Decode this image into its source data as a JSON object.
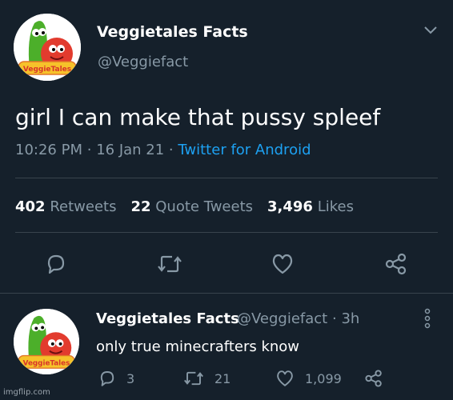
{
  "tweet": {
    "display_name": "Veggietales Facts",
    "handle": "@Veggiefact",
    "text": "girl I can make that pussy spleef",
    "time": "10:26 PM",
    "date": "16 Jan 21",
    "separator": "·",
    "source": "Twitter for Android",
    "stats": {
      "retweets_count": "402",
      "retweets_label": "Retweets",
      "quotes_count": "22",
      "quotes_label": "Quote Tweets",
      "likes_count": "3,496",
      "likes_label": "Likes"
    },
    "actions": [
      "reply-icon",
      "retweet-icon",
      "like-icon",
      "share-icon"
    ]
  },
  "reply": {
    "display_name": "Veggietales Facts",
    "handle": "@Veggiefact",
    "separator": "·",
    "age": "3h",
    "text": "only true minecrafters know",
    "reply_count": "3",
    "retweet_count": "21",
    "like_count": "1,099"
  },
  "avatar": {
    "logo_text": "VeggieTales"
  },
  "watermark": "imgflip.com",
  "colors": {
    "background": "#15202b",
    "secondary_text": "#8899a6",
    "link": "#1da1f2",
    "divider": "#38444d"
  }
}
